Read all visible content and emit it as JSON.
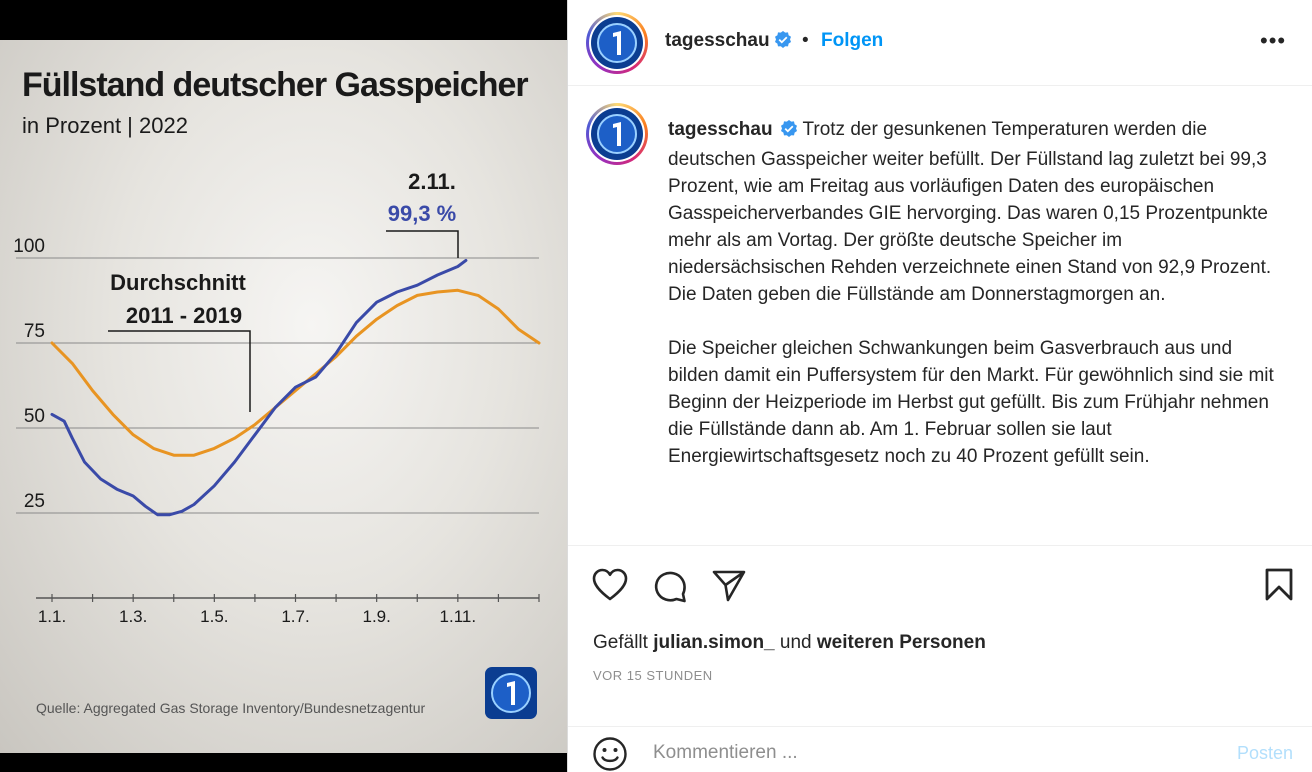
{
  "chart_data": {
    "type": "line",
    "title": "Füllstand deutscher Gasspeicher",
    "subtitle": "in Prozent | 2022",
    "y_ticks": [
      100,
      75,
      50,
      25
    ],
    "x_ticks": [
      "1.1.",
      "1.3.",
      "1.5.",
      "1.7.",
      "1.9.",
      "1.11."
    ],
    "ylim": [
      0,
      100
    ],
    "xlim_months": [
      0,
      12
    ],
    "grid": true,
    "series": [
      {
        "name": "2022",
        "color": "#3a4aa8",
        "points": [
          [
            0,
            54
          ],
          [
            0.3,
            52
          ],
          [
            0.5,
            47
          ],
          [
            0.8,
            40
          ],
          [
            1.2,
            35
          ],
          [
            1.6,
            32
          ],
          [
            2.0,
            30
          ],
          [
            2.3,
            27
          ],
          [
            2.6,
            24.5
          ],
          [
            2.9,
            24.5
          ],
          [
            3.2,
            25.5
          ],
          [
            3.5,
            27.5
          ],
          [
            4.0,
            33
          ],
          [
            4.5,
            40
          ],
          [
            5.0,
            48
          ],
          [
            5.5,
            56
          ],
          [
            6.0,
            62
          ],
          [
            6.5,
            65
          ],
          [
            7.0,
            72
          ],
          [
            7.5,
            81
          ],
          [
            8.0,
            87
          ],
          [
            8.5,
            90
          ],
          [
            9.0,
            92
          ],
          [
            9.5,
            95
          ],
          [
            10.0,
            97.5
          ],
          [
            10.2,
            99.3
          ]
        ]
      },
      {
        "name": "Durchschnitt 2011 - 2019",
        "color": "#e89422",
        "points": [
          [
            0,
            75
          ],
          [
            0.5,
            69
          ],
          [
            1.0,
            61
          ],
          [
            1.5,
            54
          ],
          [
            2.0,
            48
          ],
          [
            2.5,
            44
          ],
          [
            3.0,
            42
          ],
          [
            3.5,
            42
          ],
          [
            4.0,
            44
          ],
          [
            4.5,
            47
          ],
          [
            5.0,
            51
          ],
          [
            5.5,
            56
          ],
          [
            6.0,
            61
          ],
          [
            6.5,
            66
          ],
          [
            7.0,
            71
          ],
          [
            7.5,
            77
          ],
          [
            8.0,
            82
          ],
          [
            8.5,
            86
          ],
          [
            9.0,
            89
          ],
          [
            9.5,
            90
          ],
          [
            10.0,
            90.5
          ],
          [
            10.5,
            89
          ],
          [
            11.0,
            85
          ],
          [
            11.5,
            79
          ],
          [
            12,
            75
          ]
        ]
      }
    ],
    "annotations": {
      "latest_date": "2.11.",
      "latest_value": "99,3 %",
      "avg_label_1": "Durchschnitt",
      "avg_label_2": "2011 - 2019"
    },
    "source": "Quelle: Aggregated Gas Storage Inventory/Bundesnetzagentur"
  },
  "post": {
    "username": "tagesschau",
    "follow_label": "Folgen",
    "more_label": "•••",
    "caption_p1": "Trotz der gesunkenen Temperaturen werden die deutschen Gasspeicher weiter befüllt. Der Füllstand lag zuletzt bei 99,3 Prozent, wie am Freitag aus vorläufigen Daten des europäischen Gasspeicherverbandes GIE hervorging. Das waren 0,15 Prozentpunkte mehr als am Vortag. Der größte deutsche Speicher im niedersächsischen Rehden verzeichnete einen Stand von 92,9 Prozent. Die Daten geben die Füllstände am Donnerstagmorgen an.",
    "caption_p2": "Die Speicher gleichen Schwankungen beim Gasverbrauch aus und bilden damit ein Puffersystem für den Markt. Für gewöhnlich sind sie mit Beginn der Heizperiode im Herbst gut gefüllt. Bis zum Frühjahr nehmen die Füllstände dann ab. Am 1. Februar sollen sie laut Energiewirtschaftsgesetz noch zu 40 Prozent gefüllt sein.",
    "likes_prefix": "Gefällt",
    "likes_user": "julian.simon_",
    "likes_mid": "und",
    "likes_suffix": "weiteren Personen",
    "time_ago": "VOR 15 STUNDEN",
    "comment_placeholder": "Kommentieren ...",
    "post_label": "Posten"
  },
  "colors": {
    "brand_blue": "#0095f6",
    "verified": "#3897f0",
    "series_2022": "#3a4aa8",
    "series_avg": "#e89422"
  },
  "icons": [
    "tagesschau-logo",
    "verified-icon",
    "heart-icon",
    "comment-icon",
    "share-icon",
    "bookmark-icon",
    "emoji-icon",
    "more-icon"
  ]
}
